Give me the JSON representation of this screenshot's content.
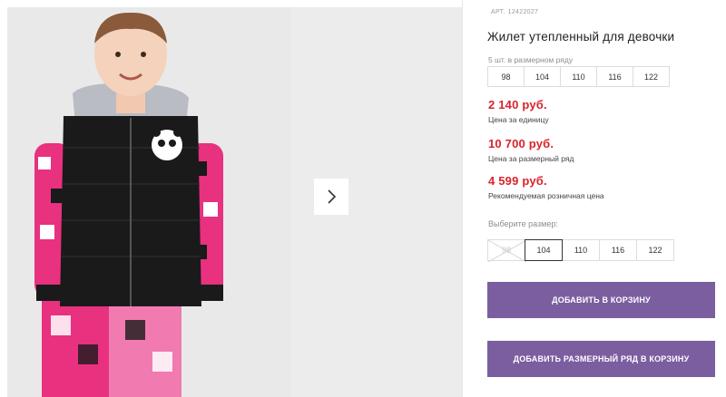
{
  "product": {
    "sku_label": "АРТ.",
    "sku": "12422027",
    "title": "Жилет утепленный для девочки"
  },
  "size_set": {
    "note": "5 шт. в размерном ряду",
    "sizes": [
      "98",
      "104",
      "110",
      "116",
      "122"
    ]
  },
  "prices": {
    "unit": {
      "value": "2 140 руб.",
      "label": "Цена за единицу"
    },
    "set": {
      "value": "10 700 руб.",
      "label": "Цена за размерный ряд"
    },
    "retail": {
      "value": "4 599 руб.",
      "label": "Рекомендуемая розничная цена"
    }
  },
  "size_select": {
    "label": "Выберите размер:",
    "options": [
      "98",
      "104",
      "110",
      "116",
      "122"
    ],
    "selected": "104",
    "unavailable": [
      "98"
    ]
  },
  "buttons": {
    "add_to_cart": "ДОБАВИТЬ В КОРЗИНУ",
    "add_set_to_cart": "ДОБАВИТЬ РАЗМЕРНЫЙ РЯД В КОРЗИНУ"
  },
  "colors": {
    "price": "#d8232a",
    "button": "#7b5ea0",
    "vest": "#1a1a1a",
    "print_pink": "#e8317f"
  },
  "icons": {
    "next": "chevron-right-icon"
  }
}
